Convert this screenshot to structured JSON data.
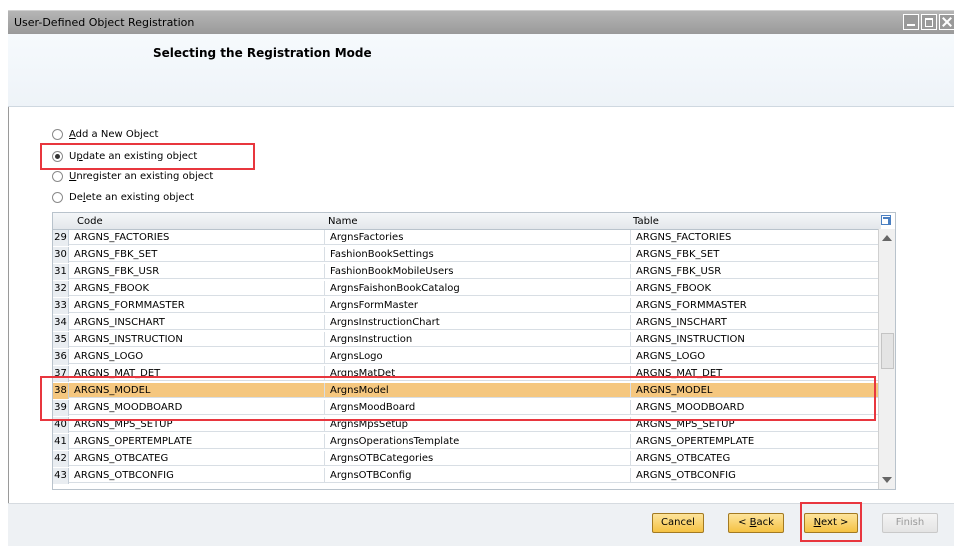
{
  "window": {
    "title": "User-Defined Object Registration"
  },
  "header": {
    "title": "Selecting the Registration Mode"
  },
  "radios": [
    {
      "label": "Add a New Object",
      "checked": false
    },
    {
      "label": "Update an existing object",
      "checked": true
    },
    {
      "label": "Unregister an existing object",
      "checked": false
    },
    {
      "label": "Delete an existing object",
      "checked": false
    }
  ],
  "grid": {
    "columns": [
      "Code",
      "Name",
      "Table"
    ],
    "rows": [
      {
        "n": "29",
        "code": "ARGNS_FACTORIES",
        "name": "ArgnsFactories",
        "table": "ARGNS_FACTORIES"
      },
      {
        "n": "30",
        "code": "ARGNS_FBK_SET",
        "name": "FashionBookSettings",
        "table": "ARGNS_FBK_SET"
      },
      {
        "n": "31",
        "code": "ARGNS_FBK_USR",
        "name": "FashionBookMobileUsers",
        "table": "ARGNS_FBK_USR"
      },
      {
        "n": "32",
        "code": "ARGNS_FBOOK",
        "name": "ArgnsFaishonBookCatalog",
        "table": "ARGNS_FBOOK"
      },
      {
        "n": "33",
        "code": "ARGNS_FORMMASTER",
        "name": "ArgnsFormMaster",
        "table": "ARGNS_FORMMASTER"
      },
      {
        "n": "34",
        "code": "ARGNS_INSCHART",
        "name": "ArgnsInstructionChart",
        "table": "ARGNS_INSCHART"
      },
      {
        "n": "35",
        "code": "ARGNS_INSTRUCTION",
        "name": "ArgnsInstruction",
        "table": "ARGNS_INSTRUCTION"
      },
      {
        "n": "36",
        "code": "ARGNS_LOGO",
        "name": "ArgnsLogo",
        "table": "ARGNS_LOGO"
      },
      {
        "n": "37",
        "code": "ARGNS_MAT_DET",
        "name": "ArgnsMatDet",
        "table": "ARGNS_MAT_DET"
      },
      {
        "n": "38",
        "code": "ARGNS_MODEL",
        "name": "ArgnsModel",
        "table": "ARGNS_MODEL"
      },
      {
        "n": "39",
        "code": "ARGNS_MOODBOARD",
        "name": "ArgnsMoodBoard",
        "table": "ARGNS_MOODBOARD"
      },
      {
        "n": "40",
        "code": "ARGNS_MPS_SETUP",
        "name": "ArgnsMpsSetup",
        "table": "ARGNS_MPS_SETUP"
      },
      {
        "n": "41",
        "code": "ARGNS_OPERTEMPLATE",
        "name": "ArgnsOperationsTemplate",
        "table": "ARGNS_OPERTEMPLATE"
      },
      {
        "n": "42",
        "code": "ARGNS_OTBCATEG",
        "name": "ArgnsOTBCategories",
        "table": "ARGNS_OTBCATEG"
      },
      {
        "n": "43",
        "code": "ARGNS_OTBCONFIG",
        "name": "ArgnsOTBConfig",
        "table": "ARGNS_OTBCONFIG"
      }
    ],
    "selected_row": "38"
  },
  "buttons": {
    "cancel": "Cancel",
    "back": "< Back",
    "next": "Next >",
    "finish": "Finish"
  },
  "colors": {
    "selected_row": "#f5c77f",
    "highlight_box": "#e8363e",
    "button": "#f5c243"
  }
}
